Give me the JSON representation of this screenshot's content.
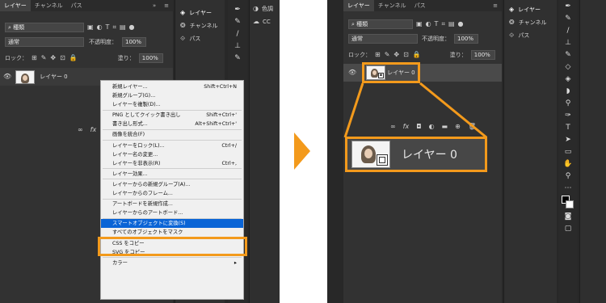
{
  "left": {
    "tabs": [
      "レイヤー",
      "チャンネル",
      "パス"
    ],
    "filter_kind": "種類",
    "blend_mode": "通常",
    "opacity_label": "不透明度：",
    "opacity_value": "100%",
    "lock_label": "ロック：",
    "fill_label": "塗り：",
    "fill_value": "100%",
    "layer_name": "レイヤー 0",
    "side_panel": [
      "レイヤー",
      "チャンネル",
      "パス"
    ],
    "right_edge": [
      "色調",
      "CC"
    ]
  },
  "context_menu": {
    "items": [
      {
        "label": "新規レイヤー...",
        "shortcut": "Shift+Ctrl+N"
      },
      {
        "label": "新規グループ(G)...",
        "shortcut": ""
      },
      {
        "label": "レイヤーを複製(D)...",
        "shortcut": ""
      },
      {
        "sep": true
      },
      {
        "label": "PNG としてクイック書き出し",
        "shortcut": "Shift+Ctrl+'"
      },
      {
        "label": "書き出し形式...",
        "shortcut": "Alt+Shift+Ctrl+'"
      },
      {
        "sep": true
      },
      {
        "label": "画像を統合(F)",
        "shortcut": ""
      },
      {
        "sep": true
      },
      {
        "label": "レイヤーをロック(L)...",
        "shortcut": "Ctrl+/"
      },
      {
        "label": "レイヤー名の変更...",
        "shortcut": ""
      },
      {
        "label": "レイヤーを非表示(R)",
        "shortcut": "Ctrl+,"
      },
      {
        "sep": true
      },
      {
        "label": "レイヤー効果...",
        "shortcut": ""
      },
      {
        "sep": true
      },
      {
        "label": "レイヤーからの新規グループ(A)...",
        "shortcut": ""
      },
      {
        "label": "レイヤーからのフレーム...",
        "shortcut": ""
      },
      {
        "sep": true
      },
      {
        "label": "アートボードを新規作成...",
        "shortcut": ""
      },
      {
        "label": "レイヤーからのアートボード...",
        "shortcut": ""
      },
      {
        "sep": true
      },
      {
        "label": "スマートオブジェクトに変換(S)",
        "shortcut": "",
        "highlight": true
      },
      {
        "label": "すべてのオブジェクトをマスク",
        "shortcut": ""
      },
      {
        "sep": true
      },
      {
        "label": "CSS をコピー",
        "shortcut": ""
      },
      {
        "label": "SVG をコピー",
        "shortcut": ""
      },
      {
        "sep": true
      },
      {
        "label": "カラー",
        "shortcut": "▸"
      }
    ]
  },
  "right": {
    "tabs": [
      "レイヤー",
      "チャンネル",
      "パス"
    ],
    "filter_kind": "種類",
    "blend_mode": "通常",
    "opacity_label": "不透明度：",
    "opacity_value": "100%",
    "lock_label": "ロック：",
    "fill_label": "塗り：",
    "fill_value": "100%",
    "layer_name": "レイヤー 0",
    "zoom_layer_name": "レイヤー 0",
    "side_panel": [
      "レイヤー",
      "チャンネル",
      "パス"
    ]
  },
  "colors": {
    "accent": "#f39a1c",
    "highlight": "#0a64d6",
    "panel": "#323232"
  }
}
